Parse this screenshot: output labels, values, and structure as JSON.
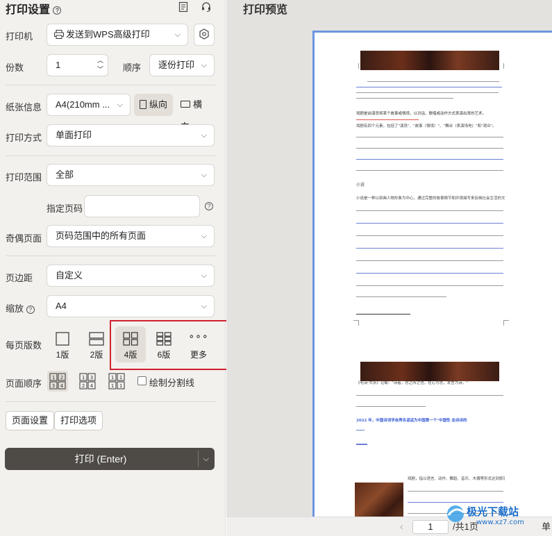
{
  "left_panel": {
    "title": "打印设置",
    "printer": {
      "label": "打印机",
      "value": "发送到WPS高级打印"
    },
    "copies": {
      "label": "份数",
      "value": "1"
    },
    "order": {
      "label": "顺序",
      "value": "逐份打印"
    },
    "paper": {
      "label": "纸张信息",
      "value": "A4(210mm ...",
      "portrait": "纵向",
      "landscape": "横向"
    },
    "print_mode": {
      "label": "打印方式",
      "value": "单面打印"
    },
    "print_range": {
      "label": "打印范围",
      "value": "全部"
    },
    "page_spec": {
      "label": "指定页码",
      "value": ""
    },
    "odd_even": {
      "label": "奇偶页面",
      "value": "页码范围中的所有页面"
    },
    "margin": {
      "label": "页边距",
      "value": "自定义"
    },
    "scale": {
      "label": "缩放",
      "value": "A4"
    },
    "pages_per_sheet": {
      "label": "每页版数",
      "options": [
        "1版",
        "2版",
        "4版",
        "6版",
        "更多"
      ],
      "selected": "4版"
    },
    "page_order": {
      "label": "页面顺序",
      "option1": "1 2 / 3 4",
      "option2": "1 3 / 2 4",
      "option3": "1 1 / 1 1"
    },
    "draw_divider": {
      "label": "绘制分割线",
      "checked": false
    },
    "page_setup_button": "页面设置",
    "print_options_button": "打印选项",
    "print_button": "打印 (Enter)"
  },
  "preview": {
    "title": "打印预览",
    "current_page": "1",
    "total_pages": "/共1页",
    "single_label": "单",
    "doc_heading_blue": "2022 年，中国诗词学会秀名诺返为中国第一个\"中国性 态诗诗的",
    "doc_paragraph1": "戏剧是由演员将某个故事或情境，以对话、歌唱或动作方式表演出来的艺术。",
    "doc_paragraph2": "戏剧有四个元素，包括了\"演员\"、\"故事（情境）\"、\"舞台（表演场地）\"和\"观众\"。",
    "doc_novel_title": "小说",
    "doc_paragraph3": "小说是一种以刻画人物形象为中心，通过完整的故事情节和环境描写来反映社会生活的文学体裁。",
    "doc_paragraph4": "《毛诗·大序》记载：\"诗者，志之所之也，在心为志，发言为诗。\"",
    "doc_paragraph5": "戏剧，指以语言、动作、舞蹈、音乐、木偶等形式达到叙事目的的舞台表演艺术的总称。"
  },
  "watermark": {
    "text": "极光下载站",
    "url": "www.xz7.com"
  },
  "colors": {
    "accent_active": "#e3ded7",
    "print_button": "#4e4a45",
    "highlight_box": "#d0202e",
    "paper_border": "#6d95e0"
  }
}
